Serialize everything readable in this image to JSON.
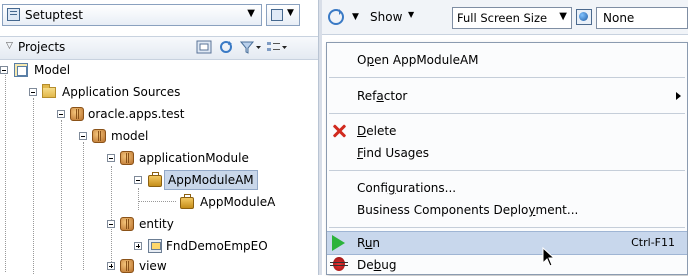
{
  "app_combo": {
    "label": "Setuptest",
    "icon": "application-icon"
  },
  "projects_panel": {
    "title": "Projects"
  },
  "tree": {
    "model": "Model",
    "application_sources": "Application Sources",
    "pkg_oracle": "oracle.apps.test",
    "pkg_model": "model",
    "pkg_app_module": "applicationModule",
    "app_module_am": "AppModuleAM",
    "app_module_child": "AppModuleA",
    "pkg_entity": "entity",
    "fnd_demo": "FndDemoEmpEO",
    "pkg_view": "view"
  },
  "toolbar": {
    "show_label": "Show",
    "size_value": "Full Screen Size",
    "none_value": "None"
  },
  "context_menu": {
    "open": {
      "pre": "O",
      "u": "p",
      "post": "en AppModuleAM"
    },
    "refactor": {
      "pre": "Ref",
      "u": "a",
      "post": "ctor"
    },
    "delete": {
      "pre": "",
      "u": "D",
      "post": "elete"
    },
    "find_usages": {
      "pre": "",
      "u": "F",
      "post": "ind Usages"
    },
    "configurations": {
      "pre": "Confi",
      "u": "g",
      "post": "urations..."
    },
    "bc_deployment": {
      "pre": "Business Components Deplo",
      "u": "y",
      "post": "ment..."
    },
    "run": {
      "pre": "R",
      "u": "u",
      "post": "n",
      "accelerator": "Ctrl-F11"
    },
    "debug": {
      "pre": "De",
      "u": "b",
      "post": "ug"
    }
  },
  "colors": {
    "menu_highlight": "#c8d7ec",
    "selection": "#c9d7ea",
    "run_green": "#2bb33b",
    "delete_red": "#d12a1e"
  }
}
